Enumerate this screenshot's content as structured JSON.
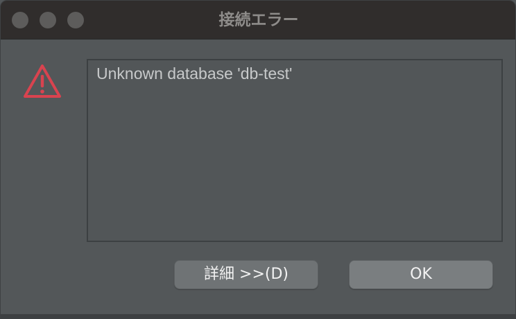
{
  "window": {
    "title": "接続エラー"
  },
  "dialog": {
    "icon": "warning-icon",
    "message": "Unknown database 'db-test'",
    "buttons": {
      "details_label": "詳細 >>(D)",
      "ok_label": "OK"
    }
  },
  "colors": {
    "titlebar": "#302d2c",
    "background": "#535759",
    "warning": "#d9434f",
    "button": "#6f7375"
  }
}
